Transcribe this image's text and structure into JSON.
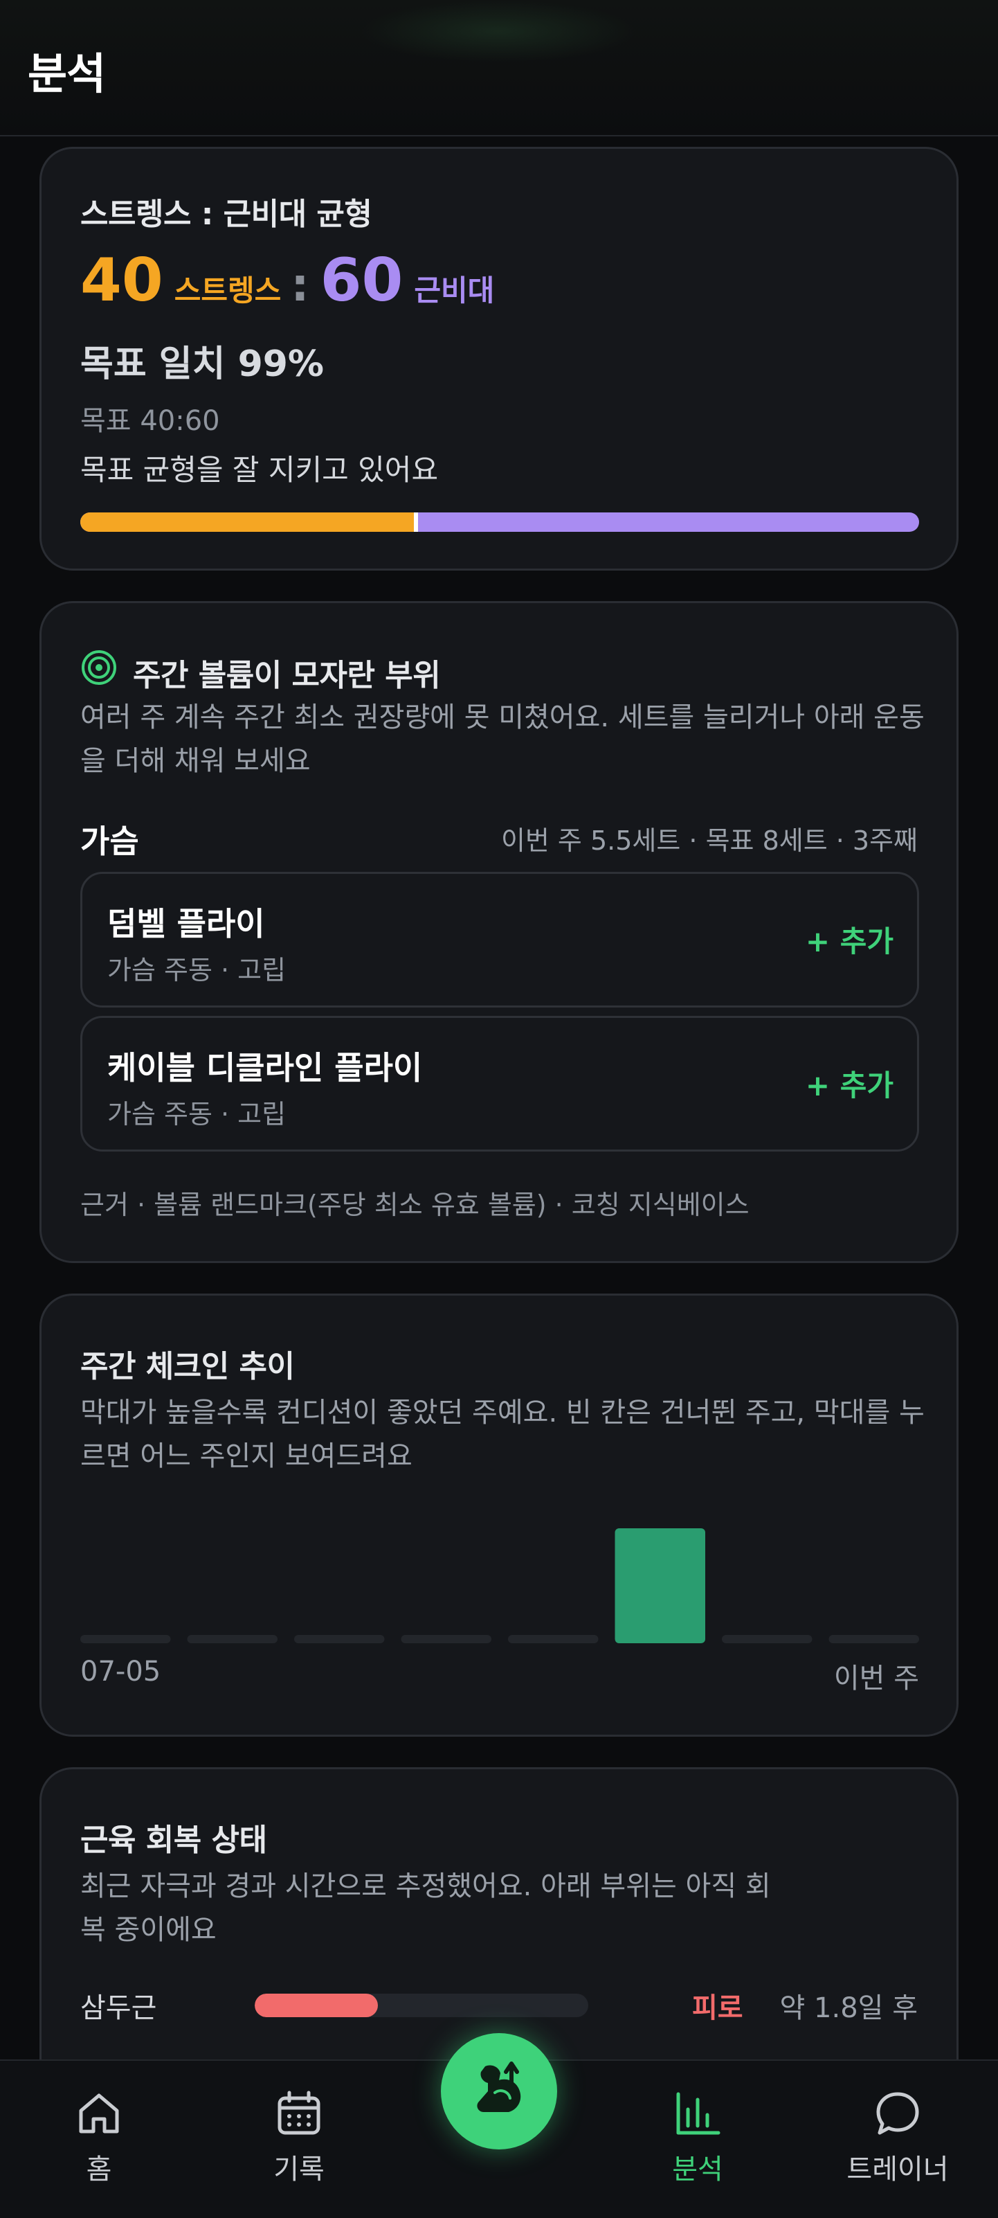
{
  "header": {
    "title": "분석"
  },
  "balance_card": {
    "title": "스트렝스 : 근비대 균형",
    "strength_value": "40",
    "strength_label": "스트렝스",
    "separator": ":",
    "hypertrophy_value": "60",
    "hypertrophy_label": "근비대",
    "match_text": "목표 일치 99%",
    "target_text": "목표 40:60",
    "status_text": "목표 균형을 잘 지키고 있어요",
    "strength_fraction": 0.4,
    "target_fraction": 0.4,
    "colors": {
      "strength": "#f5a623",
      "hypertrophy": "#a98cf2"
    }
  },
  "volume_card": {
    "icon": "target-icon",
    "title": "주간 볼륨이 모자란 부위",
    "desc": "여러 주 계속 주간 최소 권장량에 못 미쳤어요. 세트를 늘리거나 아래 운동을 더해 채워 보세요",
    "part": "가슴",
    "part_meta": "이번 주 5.5세트 · 목표 8세트 · 3주째",
    "exercises": [
      {
        "name": "덤벨 플라이",
        "sub": "가슴 주동 · 고립",
        "action": "+ 추가"
      },
      {
        "name": "케이블 디클라인 플라이",
        "sub": "가슴 주동 · 고립",
        "action": "+ 추가"
      }
    ],
    "source": "근거 · 볼륨 랜드마크(주당 최소 유효 볼륨) · 코칭 지식베이스"
  },
  "checkin_card": {
    "title": "주간 체크인 추이",
    "desc": "막대가 높을수록 컨디션이 좋았던 주예요. 빈 칸은 건너뛴 주고, 막대를 누르면 어느 주인지 보여드려요",
    "start_label": "07-05",
    "end_label": "이번 주",
    "chart_data": {
      "type": "bar",
      "categories": [
        "",
        "",
        "",
        "",
        "",
        "",
        "",
        ""
      ],
      "values": [
        0,
        0,
        0,
        0,
        0,
        1,
        0,
        0
      ],
      "colors": {
        "bar": "#2a9d70",
        "empty": "#23262b"
      }
    }
  },
  "recovery_card": {
    "title": "근육 회복 상태",
    "desc": "최근 자극과 경과 시간으로 추정했어요. 아래 부위는 아직 회복 중이에요",
    "items": [
      {
        "muscle": "삼두근",
        "recovery_fraction": 0.37,
        "state": "피로",
        "eta": "약 1.8일 후"
      }
    ],
    "colors": {
      "fatigue": "#f26b6b"
    }
  },
  "bottom_nav": {
    "items": [
      {
        "label": "홈",
        "icon": "home-icon"
      },
      {
        "label": "기록",
        "icon": "calendar-icon"
      },
      {
        "label": "분석",
        "icon": "bar-chart-icon",
        "active": true
      },
      {
        "label": "트레이너",
        "icon": "chat-bubble-icon"
      }
    ],
    "fab_icon": "flexed-arm-icon",
    "accent": "#3fd27a"
  }
}
